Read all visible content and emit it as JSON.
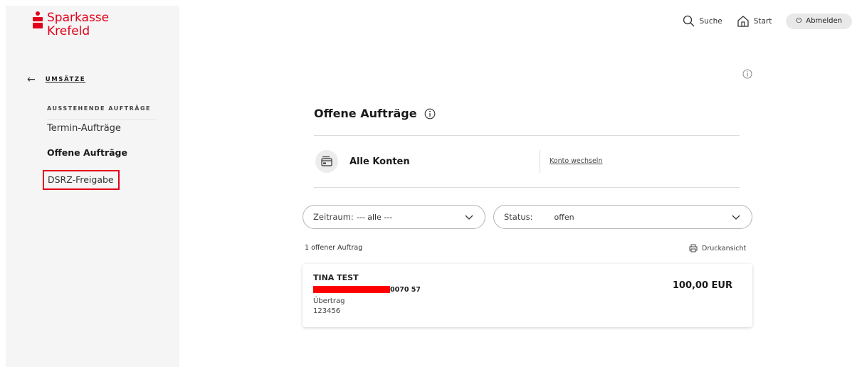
{
  "brand": {
    "line1": "Sparkasse",
    "line2": "Krefeld",
    "color": "#e2001a"
  },
  "header": {
    "search_label": "Suche",
    "start_label": "Start",
    "logout_label": "Abmelden"
  },
  "sidebar": {
    "back_label": "UMSÄTZE",
    "section_heading": "AUSSTEHENDE AUFTRÄGE",
    "items": [
      {
        "label": "Termin-Aufträge",
        "active": false
      },
      {
        "label": "Offene Aufträge",
        "active": true
      },
      {
        "label": "DSRZ-Freigabe",
        "active": false,
        "highlighted": true
      }
    ]
  },
  "main": {
    "title": "Offene Aufträge",
    "account": {
      "name": "Alle Konten",
      "switch_label": "Konto wechseln"
    },
    "filters": {
      "period_label": "Zeitraum:",
      "period_value": "--- alle ---",
      "status_label": "Status:",
      "status_value": "offen"
    },
    "result_count": "1 offener Auftrag",
    "print_label": "Druckansicht",
    "orders": [
      {
        "name": "TINA TEST",
        "iban_suffix": "0070 57",
        "type": "Übertrag",
        "reference": "123456",
        "amount": "100,00 EUR"
      }
    ]
  }
}
